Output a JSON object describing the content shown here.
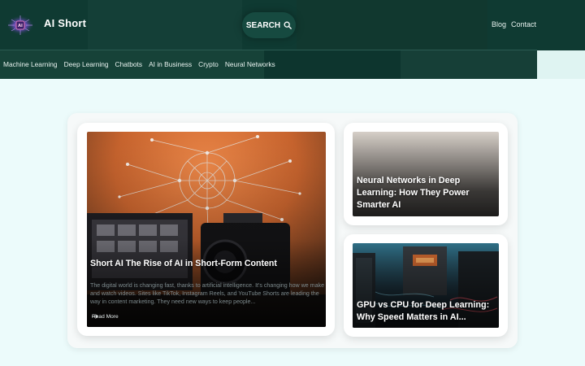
{
  "site": {
    "title": "AI Short",
    "logo_icon": "circuit-brain-icon"
  },
  "header": {
    "search_label": "SEARCH",
    "search_icon": "search-icon",
    "links": [
      "Blog",
      "Contact"
    ]
  },
  "categories": [
    "Machine Learning",
    "Deep Learning",
    "Chatbots",
    "AI in Business",
    "Crypto",
    "Neural Networks"
  ],
  "posts": {
    "featured": {
      "title": "Short AI The Rise of AI in Short-Form Content",
      "excerpt": "The digital world is changing fast, thanks to artificial intelligence. It's changing how we make and watch videos. Sites like TikTok, Instagram Reels, and YouTube Shorts are leading the way in content marketing. They need new ways to keep people...",
      "read_more": "Read More",
      "read_more_icon": "arrow-right-icon"
    },
    "side": [
      {
        "title": "Neural Networks in Deep Learning: How They Power Smarter AI"
      },
      {
        "title": "GPU vs CPU for Deep Learning: Why Speed Matters in AI..."
      }
    ]
  },
  "colors": {
    "header_bg": "#0f3a32",
    "page_bg": "#ecfbfb",
    "card_bg": "#ffffff",
    "accent_orange": "#c8642e"
  }
}
